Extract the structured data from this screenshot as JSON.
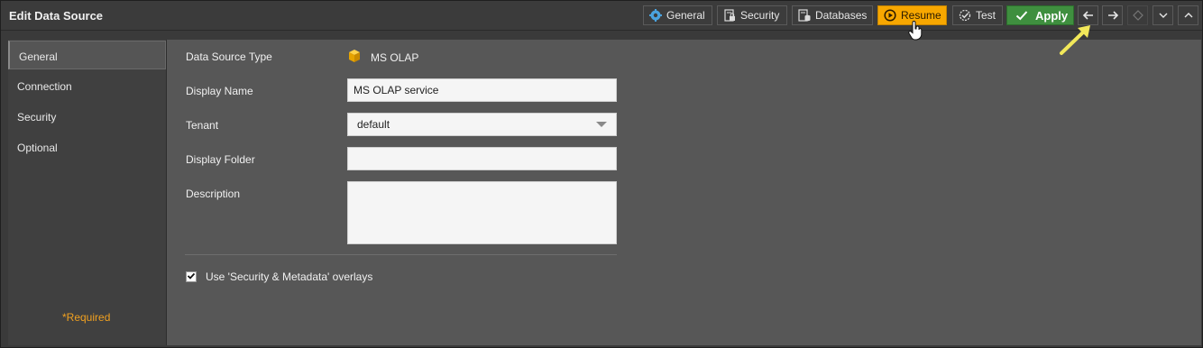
{
  "window": {
    "title": "Edit Data Source"
  },
  "toolbar": {
    "general_label": "General",
    "security_label": "Security",
    "databases_label": "Databases",
    "resume_label": "Resume",
    "test_label": "Test",
    "apply_label": "Apply",
    "icons": {
      "general": "gear-icon",
      "security": "lock-document-icon",
      "databases": "database-document-icon",
      "resume": "play-circle-icon",
      "test": "check-gear-icon",
      "apply": "checkmark-icon",
      "back": "arrow-left-icon",
      "forward": "arrow-right-icon",
      "unknown": "diamond-icon",
      "collapse": "chevron-down-icon",
      "expand": "chevron-up-icon"
    }
  },
  "sidebar": {
    "items": [
      {
        "label": "General",
        "active": true
      },
      {
        "label": "Connection",
        "active": false
      },
      {
        "label": "Security",
        "active": false
      },
      {
        "label": "Optional",
        "active": false
      }
    ],
    "required_note": "*Required"
  },
  "form": {
    "data_source_type": {
      "label": "Data Source Type",
      "value": "MS OLAP",
      "icon": "cube-icon"
    },
    "display_name": {
      "label": "Display Name",
      "value": "MS OLAP service"
    },
    "tenant": {
      "label": "Tenant",
      "value": "default"
    },
    "display_folder": {
      "label": "Display Folder",
      "value": ""
    },
    "description": {
      "label": "Description",
      "value": ""
    },
    "overlays": {
      "label": "Use 'Security & Metadata' overlays",
      "checked": true
    }
  },
  "colors": {
    "resume_bg": "#f7a700",
    "apply_bg": "#3f8f3f",
    "required_text": "#f0a020",
    "annotation_arrow": "#f2e85a"
  }
}
